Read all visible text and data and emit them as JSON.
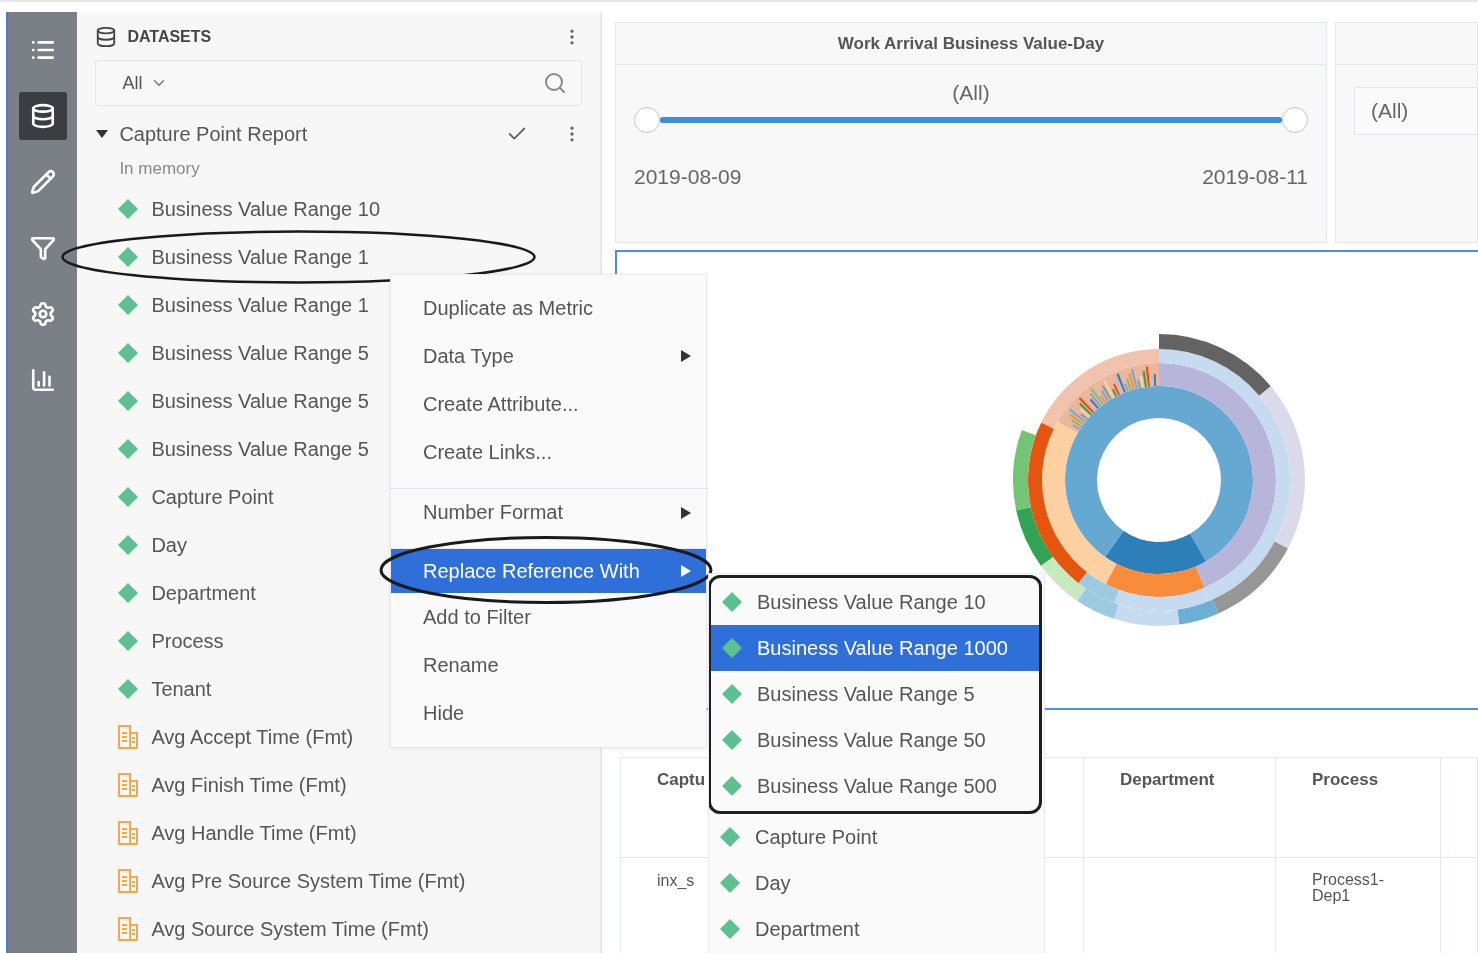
{
  "rail": [
    {
      "selected": false
    },
    {
      "selected": true
    },
    {
      "selected": false
    },
    {
      "selected": false
    },
    {
      "selected": false
    },
    {
      "selected": false
    }
  ],
  "datasets": {
    "title": "DATASETS",
    "filter": {
      "value": "All"
    },
    "dataset": {
      "name": "Capture Point Report",
      "expanded": true,
      "checked": true,
      "status": "In memory"
    },
    "items": [
      {
        "label": "Business Value Range 10",
        "kind": "attribute",
        "circled": false
      },
      {
        "label": "Business Value Range 1",
        "kind": "attribute",
        "circled": true
      },
      {
        "label": "Business Value Range 1",
        "kind": "attribute",
        "circled": false
      },
      {
        "label": "Business Value Range 5",
        "kind": "attribute",
        "circled": false
      },
      {
        "label": "Business Value Range 5",
        "kind": "attribute",
        "circled": false
      },
      {
        "label": "Business Value Range 5",
        "kind": "attribute",
        "circled": false
      },
      {
        "label": "Capture Point",
        "kind": "attribute",
        "circled": false
      },
      {
        "label": "Day",
        "kind": "attribute",
        "circled": false
      },
      {
        "label": "Department",
        "kind": "attribute",
        "circled": false
      },
      {
        "label": "Process",
        "kind": "attribute",
        "circled": false
      },
      {
        "label": "Tenant",
        "kind": "attribute",
        "circled": false
      },
      {
        "label": "Avg Accept Time (Fmt)",
        "kind": "metric",
        "circled": false
      },
      {
        "label": "Avg Finish Time (Fmt)",
        "kind": "metric",
        "circled": false
      },
      {
        "label": "Avg Handle Time (Fmt)",
        "kind": "metric",
        "circled": false
      },
      {
        "label": "Avg Pre Source System Time (Fmt)",
        "kind": "metric",
        "circled": false
      },
      {
        "label": "Avg Source System Time (Fmt)",
        "kind": "metric",
        "circled": false
      }
    ]
  },
  "filter_cards": [
    {
      "kind": "slider",
      "title": "Work Arrival Business Value-Day",
      "value": "(All)",
      "level": 1,
      "start": "2019-08-09",
      "end": "2019-08-11"
    },
    {
      "kind": "dropdown",
      "value": "(All)"
    }
  ],
  "table": {
    "columns": [
      {
        "label": "Captu"
      },
      {},
      {
        "label": "Department"
      },
      {
        "label": "Process"
      },
      {}
    ],
    "rows": [
      {
        "cells": [
          {
            "text": "inx_s"
          },
          {},
          {},
          {
            "text": "Process1-Dep1"
          },
          {}
        ]
      }
    ]
  },
  "context_menu": {
    "items": [
      {
        "label": "Duplicate as Metric",
        "has_submenu": false,
        "separator_before": false,
        "selected": false,
        "circled": false
      },
      {
        "label": "Data Type",
        "has_submenu": true,
        "separator_before": false,
        "selected": false,
        "circled": false
      },
      {
        "label": "Create Attribute...",
        "has_submenu": false,
        "separator_before": false,
        "selected": false,
        "circled": false
      },
      {
        "label": "Create Links...",
        "has_submenu": false,
        "separator_before": false,
        "selected": false,
        "circled": false
      },
      {
        "label": "Number Format",
        "has_submenu": true,
        "separator_before": true,
        "selected": false,
        "circled": false
      },
      {
        "label": "Replace Reference With",
        "has_submenu": true,
        "separator_before": true,
        "selected": true,
        "circled": true
      },
      {
        "label": "Add to Filter",
        "has_submenu": false,
        "separator_before": false,
        "selected": false,
        "circled": false
      },
      {
        "label": "Rename",
        "has_submenu": false,
        "separator_before": false,
        "selected": false,
        "circled": false
      },
      {
        "label": "Hide",
        "has_submenu": false,
        "separator_before": false,
        "selected": false,
        "circled": false
      }
    ]
  },
  "submenu": {
    "items": [
      {
        "label": "Business Value Range 10",
        "selected": false,
        "boxed": true
      },
      {
        "label": "Business Value Range 1000",
        "selected": true,
        "boxed": true
      },
      {
        "label": "Business Value Range 5",
        "selected": false,
        "boxed": true
      },
      {
        "label": "Business Value Range 50",
        "selected": false,
        "boxed": true
      },
      {
        "label": "Business Value Range 500",
        "selected": false,
        "boxed": true
      },
      {
        "label": "Capture Point",
        "selected": false,
        "boxed": false
      },
      {
        "label": "Day",
        "selected": false,
        "boxed": false
      },
      {
        "label": "Department",
        "selected": false,
        "boxed": false
      }
    ]
  }
}
